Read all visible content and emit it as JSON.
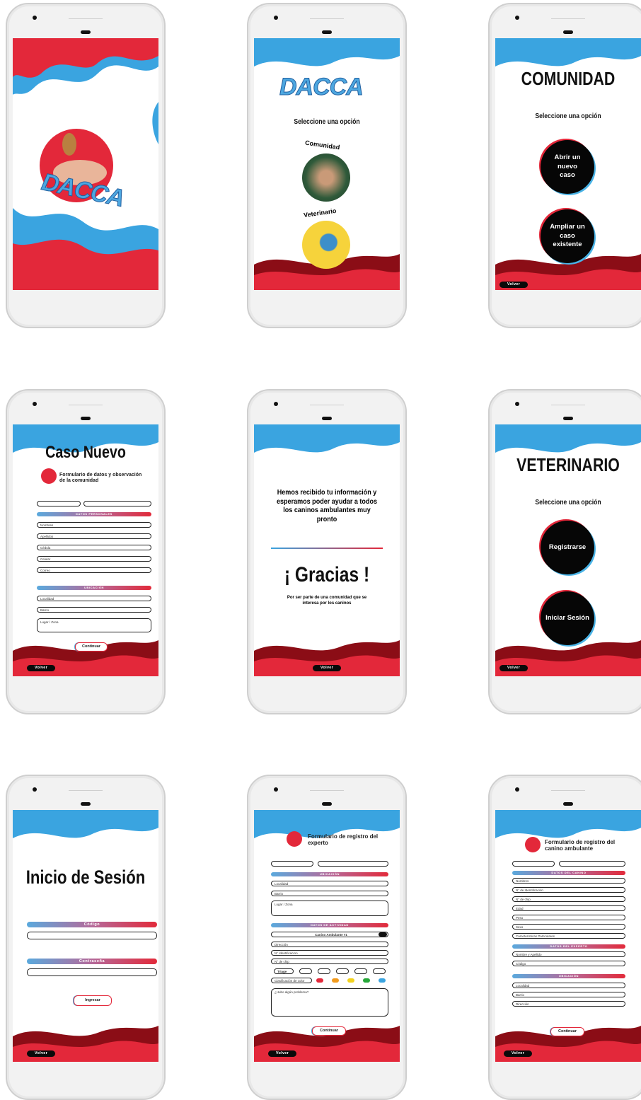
{
  "brand": "DACCA",
  "colors": {
    "red": "#e3283a",
    "blue": "#3aa4e0",
    "dark": "#060606"
  },
  "common": {
    "back_label": "Volver",
    "continue_label": "Continuar"
  },
  "screen2": {
    "subtitle": "Seleccione una opción",
    "option_community": "Comunidad",
    "option_vet": "Veterinario"
  },
  "screen3": {
    "title": "COMUNIDAD",
    "subtitle": "Seleccione una opción",
    "btn_new": "Abrir un nuevo caso",
    "btn_extend": "Ampliar un caso existente"
  },
  "screen4": {
    "title": "Caso Nuevo",
    "form_title": "Formulario de datos y observación de la comunidad",
    "section_personal": "DATOS PERSONALES",
    "personal_fields": [
      "Nombres",
      "Apellidos",
      "Cédula",
      "Celular",
      "Correo"
    ],
    "section_location": "UBICACIÓN",
    "location_fields": [
      "Localidad",
      "Barrio",
      "Lugar / Zona"
    ]
  },
  "screen5": {
    "message": "Hemos recibido tu información y esperamos poder ayudar a todos los caninos ambulantes muy pronto",
    "thanks": "¡ Gracias !",
    "thanks_sub": "Por ser parte de una comunidad que se interesa por los caninos"
  },
  "screen6": {
    "title": "VETERINARIO",
    "subtitle": "Seleccione una opción",
    "btn_register": "Registrarse",
    "btn_login": "Iniciar Sesión"
  },
  "screen7": {
    "title": "Inicio de Sesión",
    "code_label": "Código",
    "password_label": "Contraseña",
    "submit": "Ingresar"
  },
  "screen8": {
    "form_title": "Formulario de registro del experto",
    "section_location": "UBICACIÓN",
    "location_fields": [
      "Localidad",
      "Barrio",
      "Lugar / Zona"
    ],
    "section_activity": "DATOS DE ACTIVIDAD",
    "canine_select": "Canino Ambulante #1",
    "activity_fields": [
      "Dirección",
      "N° Identificación",
      "N° de chip"
    ],
    "triage_label": "Triage",
    "classification_label": "Clasificación de color",
    "notes_placeholder": "¿Hubo algún problema?"
  },
  "screen9": {
    "form_title": "Formulario de registro del canino ambulante",
    "section_canine": "DATOS DEL CANINO",
    "canine_fields": [
      "Nombres",
      "N° de Identificación",
      "N° de chip",
      "Edad",
      "Peso",
      "Sexo",
      "Características Particulares"
    ],
    "section_expert": "DATOS DEL EXPERTO",
    "expert_fields": [
      "Nombre y Apellido",
      "Código"
    ],
    "section_location": "UBICACIÓN",
    "location_fields": [
      "Localidad",
      "Barrio",
      "Dirección"
    ]
  }
}
